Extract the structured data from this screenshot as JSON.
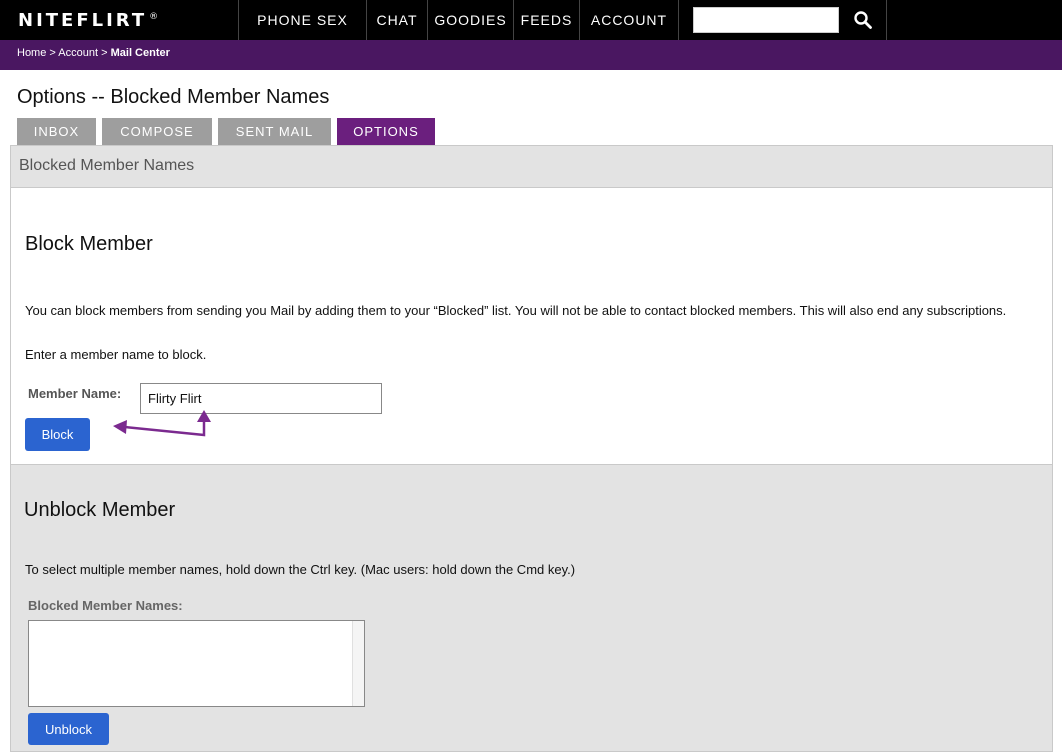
{
  "topnav": {
    "logo_text": "NITEFLIRT",
    "logo_mark": "®",
    "items": [
      {
        "label": "PHONE SEX"
      },
      {
        "label": "CHAT"
      },
      {
        "label": "GOODIES"
      },
      {
        "label": "FEEDS"
      },
      {
        "label": "ACCOUNT"
      }
    ],
    "search": {
      "value": "",
      "icon": "search-icon"
    }
  },
  "breadcrumb": {
    "home": "Home",
    "account": "Account",
    "current": "Mail Center",
    "separator": ">"
  },
  "page": {
    "title": "Options -- Blocked Member Names"
  },
  "tabs": [
    {
      "label": "INBOX",
      "active": false
    },
    {
      "label": "COMPOSE",
      "active": false
    },
    {
      "label": "SENT MAIL",
      "active": false
    },
    {
      "label": "OPTIONS",
      "active": true
    }
  ],
  "panel": {
    "header": "Blocked Member Names"
  },
  "block": {
    "heading": "Block Member",
    "description": "You can block members from sending you Mail by adding them to your “Blocked” list. You will not be able to contact blocked members. This will also end any subscriptions.",
    "prompt": "Enter a member name to block.",
    "field_label": "Member Name:",
    "field_value": "Flirty Flirt",
    "button_label": "Block"
  },
  "unblock": {
    "heading": "Unblock Member",
    "description": "To select multiple member names, hold down the Ctrl key. (Mac users: hold down the Cmd key.)",
    "list_label": "Blocked Member Names:",
    "list_items": [],
    "button_label": "Unblock"
  },
  "colors": {
    "nav_bg": "#000000",
    "breadcrumb_bg": "#4a1761",
    "active_tab": "#6b1f7e",
    "inactive_tab": "#9e9e9e",
    "button": "#2b64d0",
    "arrow": "#7b2a8f"
  }
}
